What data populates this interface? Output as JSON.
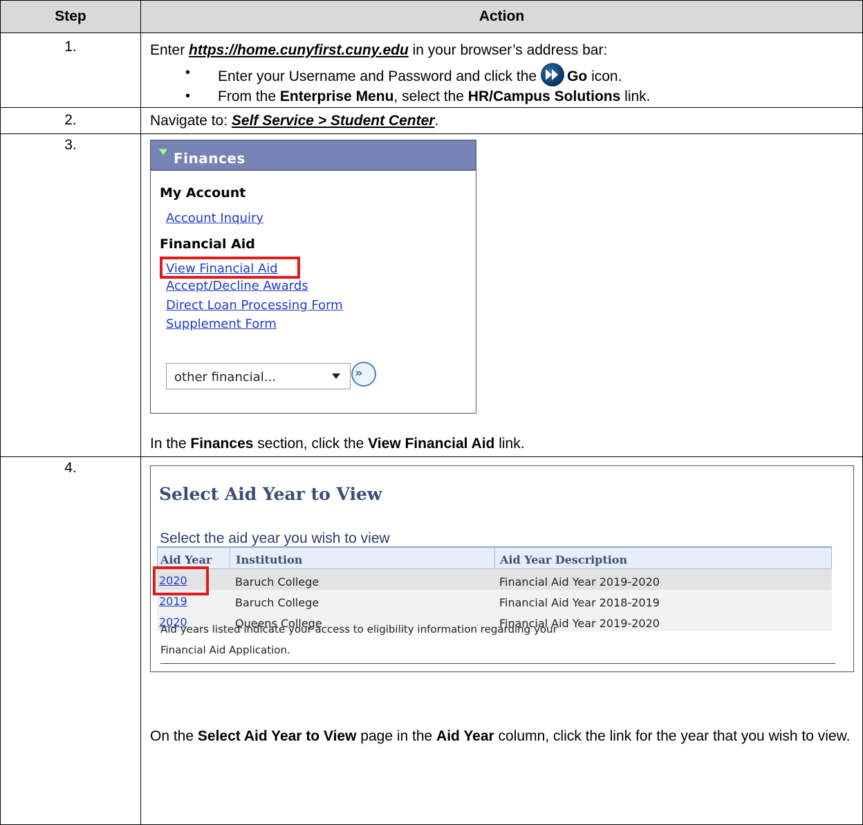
{
  "header": {
    "step": "Step",
    "action": "Action"
  },
  "steps": [
    {
      "num": "1.",
      "pre": "Enter ",
      "url": "https://home.cunyfirst.cuny.edu",
      "post": " in your browser’s address bar:",
      "bullet1_pre": "Enter your Username and Password and click the",
      "bullet1_bold": "Go",
      "bullet1_post": " icon.",
      "bullet2_pre": "From the ",
      "bullet2_b1": "Enterprise Menu",
      "bullet2_mid": ", select the ",
      "bullet2_b2": "HR/Campus Solutions",
      "bullet2_post": " link."
    },
    {
      "num": "2.",
      "pre": "Navigate to:  ",
      "path": "Self Service > Student Center",
      "post": "."
    },
    {
      "num": "3.",
      "panel": {
        "header": "Finances",
        "section1": "My Account",
        "link_account_inquiry": "Account Inquiry",
        "section2": "Financial Aid",
        "link_view_financial_aid": "View Financial Aid",
        "link_accept_decline": "Accept/Decline Awards",
        "link_direct_loan": "Direct Loan Processing Form",
        "link_supplement": "Supplement Form",
        "select_value": "other financial...",
        "go_glyph": "»"
      },
      "text_pre": "In the ",
      "text_b1": "Finances",
      "text_mid": " section, click the ",
      "text_b2": "View Financial Aid",
      "text_post": " link."
    },
    {
      "num": "4.",
      "panel": {
        "title": "Select Aid Year to View",
        "subtitle": "Select the aid year you wish to view",
        "columns": [
          "Aid Year",
          "Institution",
          "Aid Year Description"
        ],
        "rows": [
          {
            "year": "2020",
            "institution": "Baruch College",
            "description": "Financial Aid Year 2019-2020"
          },
          {
            "year": "2019",
            "institution": "Baruch College",
            "description": "Financial Aid Year 2018-2019"
          },
          {
            "year": "2020",
            "institution": "Queens College",
            "description": "Financial Aid Year 2019-2020"
          }
        ],
        "note_line1": "Aid years listed indicate your access to eligibility information regarding your",
        "note_line2": "Financial Aid Application."
      },
      "text_pre": "On the ",
      "text_b1": "Select Aid Year to View",
      "text_mid": " page in the ",
      "text_b2": "Aid Year",
      "text_post": " column, click the link for the year that you wish to view."
    }
  ]
}
